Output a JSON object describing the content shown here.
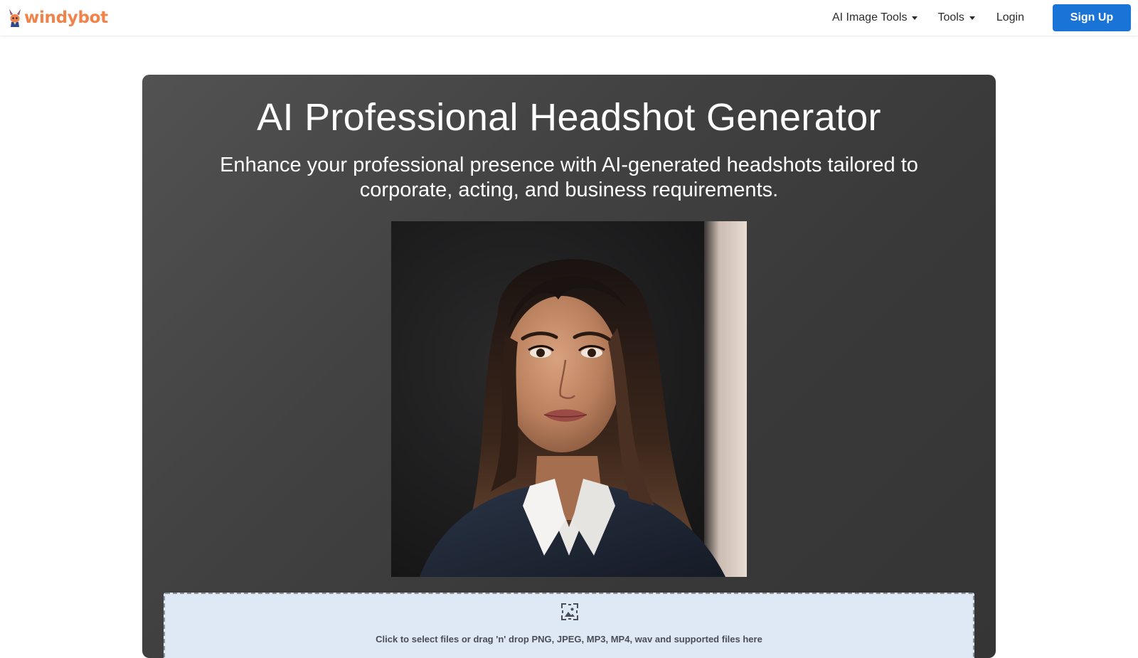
{
  "nav": {
    "brand": "windybot",
    "items": [
      {
        "label": "AI Image Tools",
        "has_dropdown": true
      },
      {
        "label": "Tools",
        "has_dropdown": true
      },
      {
        "label": "Login",
        "has_dropdown": false
      }
    ],
    "signup_label": "Sign Up"
  },
  "hero": {
    "title": "AI Professional Headshot Generator",
    "subtitle": "Enhance your professional presence with AI-generated headshots tailored to corporate, acting, and business requirements.",
    "image_icon": "portrait-photo"
  },
  "upload": {
    "icon": "image-upload-icon",
    "text": "Click to select files or drag 'n' drop PNG, JPEG, MP3, MP4, wav and supported files here"
  },
  "colors": {
    "brand": "#f0824a",
    "primary_button": "#1a73d6",
    "hero_bg": "#424242",
    "dropzone_bg": "#dfe9f6"
  }
}
